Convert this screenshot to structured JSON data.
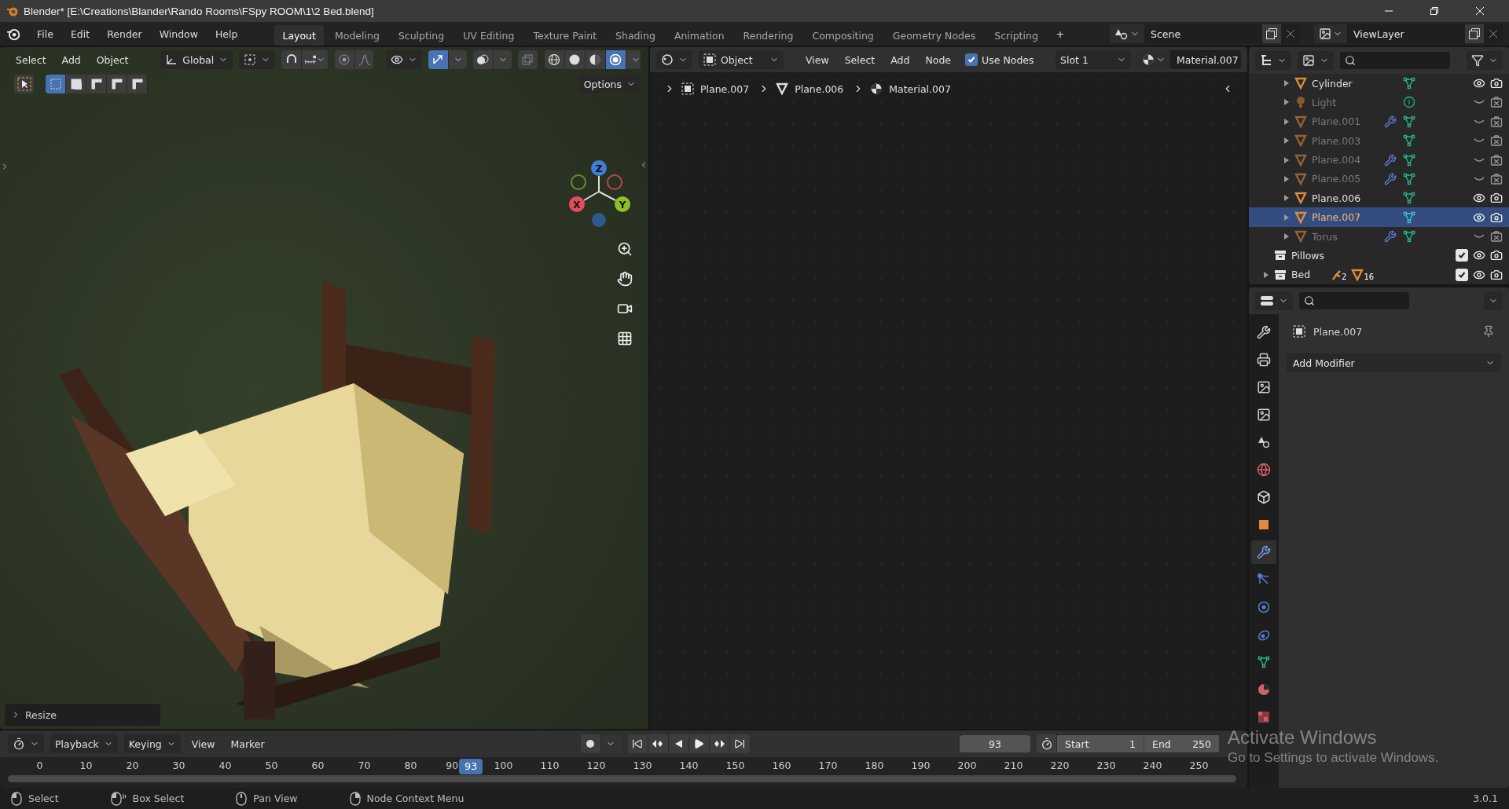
{
  "window": {
    "title": "Blender* [E:\\Creations\\Blander\\Rando Rooms\\FSpy ROOM\\1\\2 Bed.blend]"
  },
  "menu": [
    "File",
    "Edit",
    "Render",
    "Window",
    "Help"
  ],
  "workspaces": [
    {
      "label": "Layout",
      "selected": true
    },
    {
      "label": "Modeling",
      "selected": false
    },
    {
      "label": "Sculpting",
      "selected": false
    },
    {
      "label": "UV Editing",
      "selected": false
    },
    {
      "label": "Texture Paint",
      "selected": false
    },
    {
      "label": "Shading",
      "selected": false
    },
    {
      "label": "Animation",
      "selected": false
    },
    {
      "label": "Rendering",
      "selected": false
    },
    {
      "label": "Compositing",
      "selected": false
    },
    {
      "label": "Geometry Nodes",
      "selected": false
    },
    {
      "label": "Scripting",
      "selected": false
    }
  ],
  "add_workspace": "+",
  "scene": "Scene",
  "view_layer": "ViewLayer",
  "viewport": {
    "menus": [
      "Select",
      "Add",
      "Object"
    ],
    "orientation": "Global",
    "snap": {
      "on": false
    },
    "gizmos": {
      "on": true
    },
    "shading_modes": [
      {
        "kind": "wireframe",
        "selected": false
      },
      {
        "kind": "solid",
        "selected": false
      },
      {
        "kind": "material",
        "selected": false
      },
      {
        "kind": "rendered",
        "selected": true
      }
    ],
    "select_modes": [
      {
        "kind": "new",
        "selected": true
      },
      {
        "kind": "extend",
        "selected": false
      },
      {
        "kind": "subtract",
        "selected": false
      },
      {
        "kind": "invert",
        "selected": false
      },
      {
        "kind": "intersect",
        "selected": false
      }
    ],
    "options": "Options",
    "axes": [
      "Z",
      "X",
      "Y"
    ],
    "last_operator": "Resize"
  },
  "node_editor": {
    "object_type": "Object",
    "menus": [
      "View",
      "Select",
      "Add",
      "Node"
    ],
    "use_nodes": {
      "label": "Use Nodes",
      "checked": true
    },
    "slot": "Slot 1",
    "material": "Material.007",
    "breadcrumbs": [
      {
        "kind": "object",
        "label": "Plane.007"
      },
      {
        "kind": "mesh",
        "label": "Plane.006"
      },
      {
        "kind": "material",
        "label": "Material.007"
      }
    ]
  },
  "outliner": {
    "objects": [
      {
        "name": "Cylinder",
        "kind": "mesh",
        "visible": true,
        "selected": false,
        "modifier": false
      },
      {
        "name": "Light",
        "kind": "light",
        "visible": false,
        "selected": false,
        "modifier": false
      },
      {
        "name": "Plane.001",
        "kind": "mesh",
        "visible": false,
        "selected": false,
        "modifier": true
      },
      {
        "name": "Plane.003",
        "kind": "mesh",
        "visible": false,
        "selected": false,
        "modifier": false
      },
      {
        "name": "Plane.004",
        "kind": "mesh",
        "visible": false,
        "selected": false,
        "modifier": true
      },
      {
        "name": "Plane.005",
        "kind": "mesh",
        "visible": false,
        "selected": false,
        "modifier": true
      },
      {
        "name": "Plane.006",
        "kind": "mesh",
        "visible": true,
        "selected": false,
        "modifier": false
      },
      {
        "name": "Plane.007",
        "kind": "mesh",
        "visible": true,
        "selected": true,
        "modifier": false
      },
      {
        "name": "Torus",
        "kind": "mesh",
        "visible": false,
        "selected": false,
        "modifier": true
      }
    ],
    "collections": [
      {
        "name": "Pillows",
        "expandable": false,
        "checked": true,
        "visible": true
      },
      {
        "name": "Bed",
        "expandable": true,
        "checked": true,
        "visible": true,
        "child_counts": [
          {
            "kind": "armature",
            "count": "2"
          },
          {
            "kind": "mesh",
            "count": "16"
          }
        ]
      }
    ]
  },
  "properties": {
    "tabs": [
      {
        "kind": "tool",
        "selected": false
      },
      {
        "kind": "render",
        "selected": false
      },
      {
        "kind": "output",
        "selected": false
      },
      {
        "kind": "view_layer",
        "selected": false
      },
      {
        "kind": "scene",
        "selected": false
      },
      {
        "kind": "world",
        "selected": false
      },
      {
        "kind": "collection",
        "selected": false
      },
      {
        "kind": "object",
        "selected": false
      },
      {
        "kind": "modifiers",
        "selected": true
      },
      {
        "kind": "particles",
        "selected": false
      },
      {
        "kind": "physics",
        "selected": false
      },
      {
        "kind": "constraints",
        "selected": false
      },
      {
        "kind": "data",
        "selected": false
      },
      {
        "kind": "material",
        "selected": false
      },
      {
        "kind": "texture",
        "selected": false
      }
    ],
    "object_name": "Plane.007",
    "add_modifier": "Add Modifier"
  },
  "timeline": {
    "menus": [
      "Playback",
      "Keying",
      "View",
      "Marker"
    ],
    "current_frame": "93",
    "start": {
      "label": "Start",
      "value": "1"
    },
    "end": {
      "label": "End",
      "value": "250"
    },
    "ruler": [
      "0",
      "10",
      "20",
      "30",
      "40",
      "50",
      "60",
      "70",
      "80",
      "90",
      "100",
      "110",
      "120",
      "130",
      "140",
      "150",
      "160",
      "170",
      "180",
      "190",
      "200",
      "210",
      "220",
      "230",
      "240",
      "250"
    ],
    "playhead": "93"
  },
  "status_bar": {
    "hints": [
      {
        "kind": "left",
        "label": "Select"
      },
      {
        "kind": "drag",
        "label": "Box Select"
      },
      {
        "kind": "middle",
        "label": "Pan View"
      },
      {
        "kind": "right",
        "label": "Node Context Menu"
      }
    ],
    "version": "3.0.1"
  },
  "activation": {
    "title": "Activate Windows",
    "subtitle": "Go to Settings to activate Windows."
  }
}
